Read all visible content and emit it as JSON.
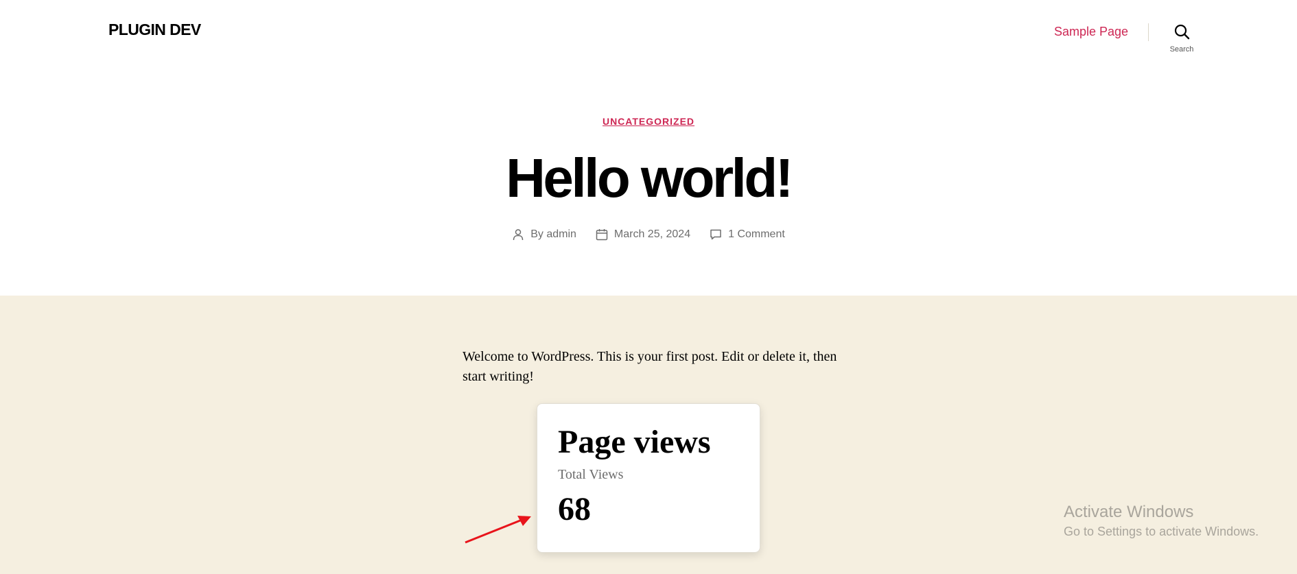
{
  "header": {
    "site_title": "PLUGIN DEV",
    "nav_link": "Sample Page",
    "search_label": "Search"
  },
  "post": {
    "category": "UNCATEGORIZED",
    "title": "Hello world!",
    "author_prefix": "By",
    "author": "admin",
    "date": "March 25, 2024",
    "comments": "1 Comment",
    "body": "Welcome to WordPress. This is your first post. Edit or delete it, then start writing!"
  },
  "widget": {
    "title": "Page views",
    "subtitle": "Total Views",
    "count": "68"
  },
  "watermark": {
    "title": "Activate Windows",
    "subtitle": "Go to Settings to activate Windows."
  },
  "icons": {
    "search": "search-icon",
    "author": "person-icon",
    "date": "calendar-icon",
    "comments": "comment-icon",
    "annotation": "red-arrow-icon"
  },
  "colors": {
    "accent": "#cd2653",
    "content_background": "#f5efe0",
    "header_background": "#ffffff",
    "annotation_arrow": "#e8141b"
  }
}
